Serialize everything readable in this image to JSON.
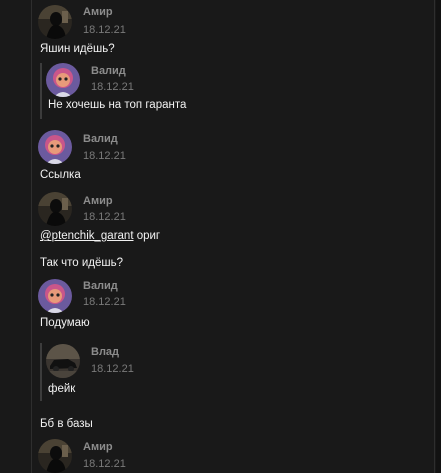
{
  "messages": [
    {
      "author": "Амир",
      "date": "18.12.21",
      "text": "Яшин идёшь?"
    },
    {
      "author": "Валид",
      "date": "18.12.21",
      "text": "Не хочешь на топ гаранта"
    },
    {
      "author": "Валид",
      "date": "18.12.21",
      "text": "Ссылка"
    },
    {
      "author": "Амир",
      "date": "18.12.21",
      "mention": "@ptenchik_garant",
      "text_after": " ориг",
      "text2": "Так что идёшь?"
    },
    {
      "author": "Валид",
      "date": "18.12.21",
      "text": "Подумаю"
    },
    {
      "author": "Влад",
      "date": "18.12.21",
      "text": "фейк"
    },
    {
      "text": "Бб в базы"
    },
    {
      "author": "Амир",
      "date": "18.12.21"
    }
  ],
  "colors": {
    "background": "#191919",
    "name": "#8c8c8c",
    "date": "#7a7a7a",
    "text": "#f2f2f2"
  },
  "icons": {
    "amir_avatar": "dark-photo-avatar",
    "valid_avatar": "purple-cartoon-avatar",
    "vlad_avatar": "car-photo-avatar"
  }
}
